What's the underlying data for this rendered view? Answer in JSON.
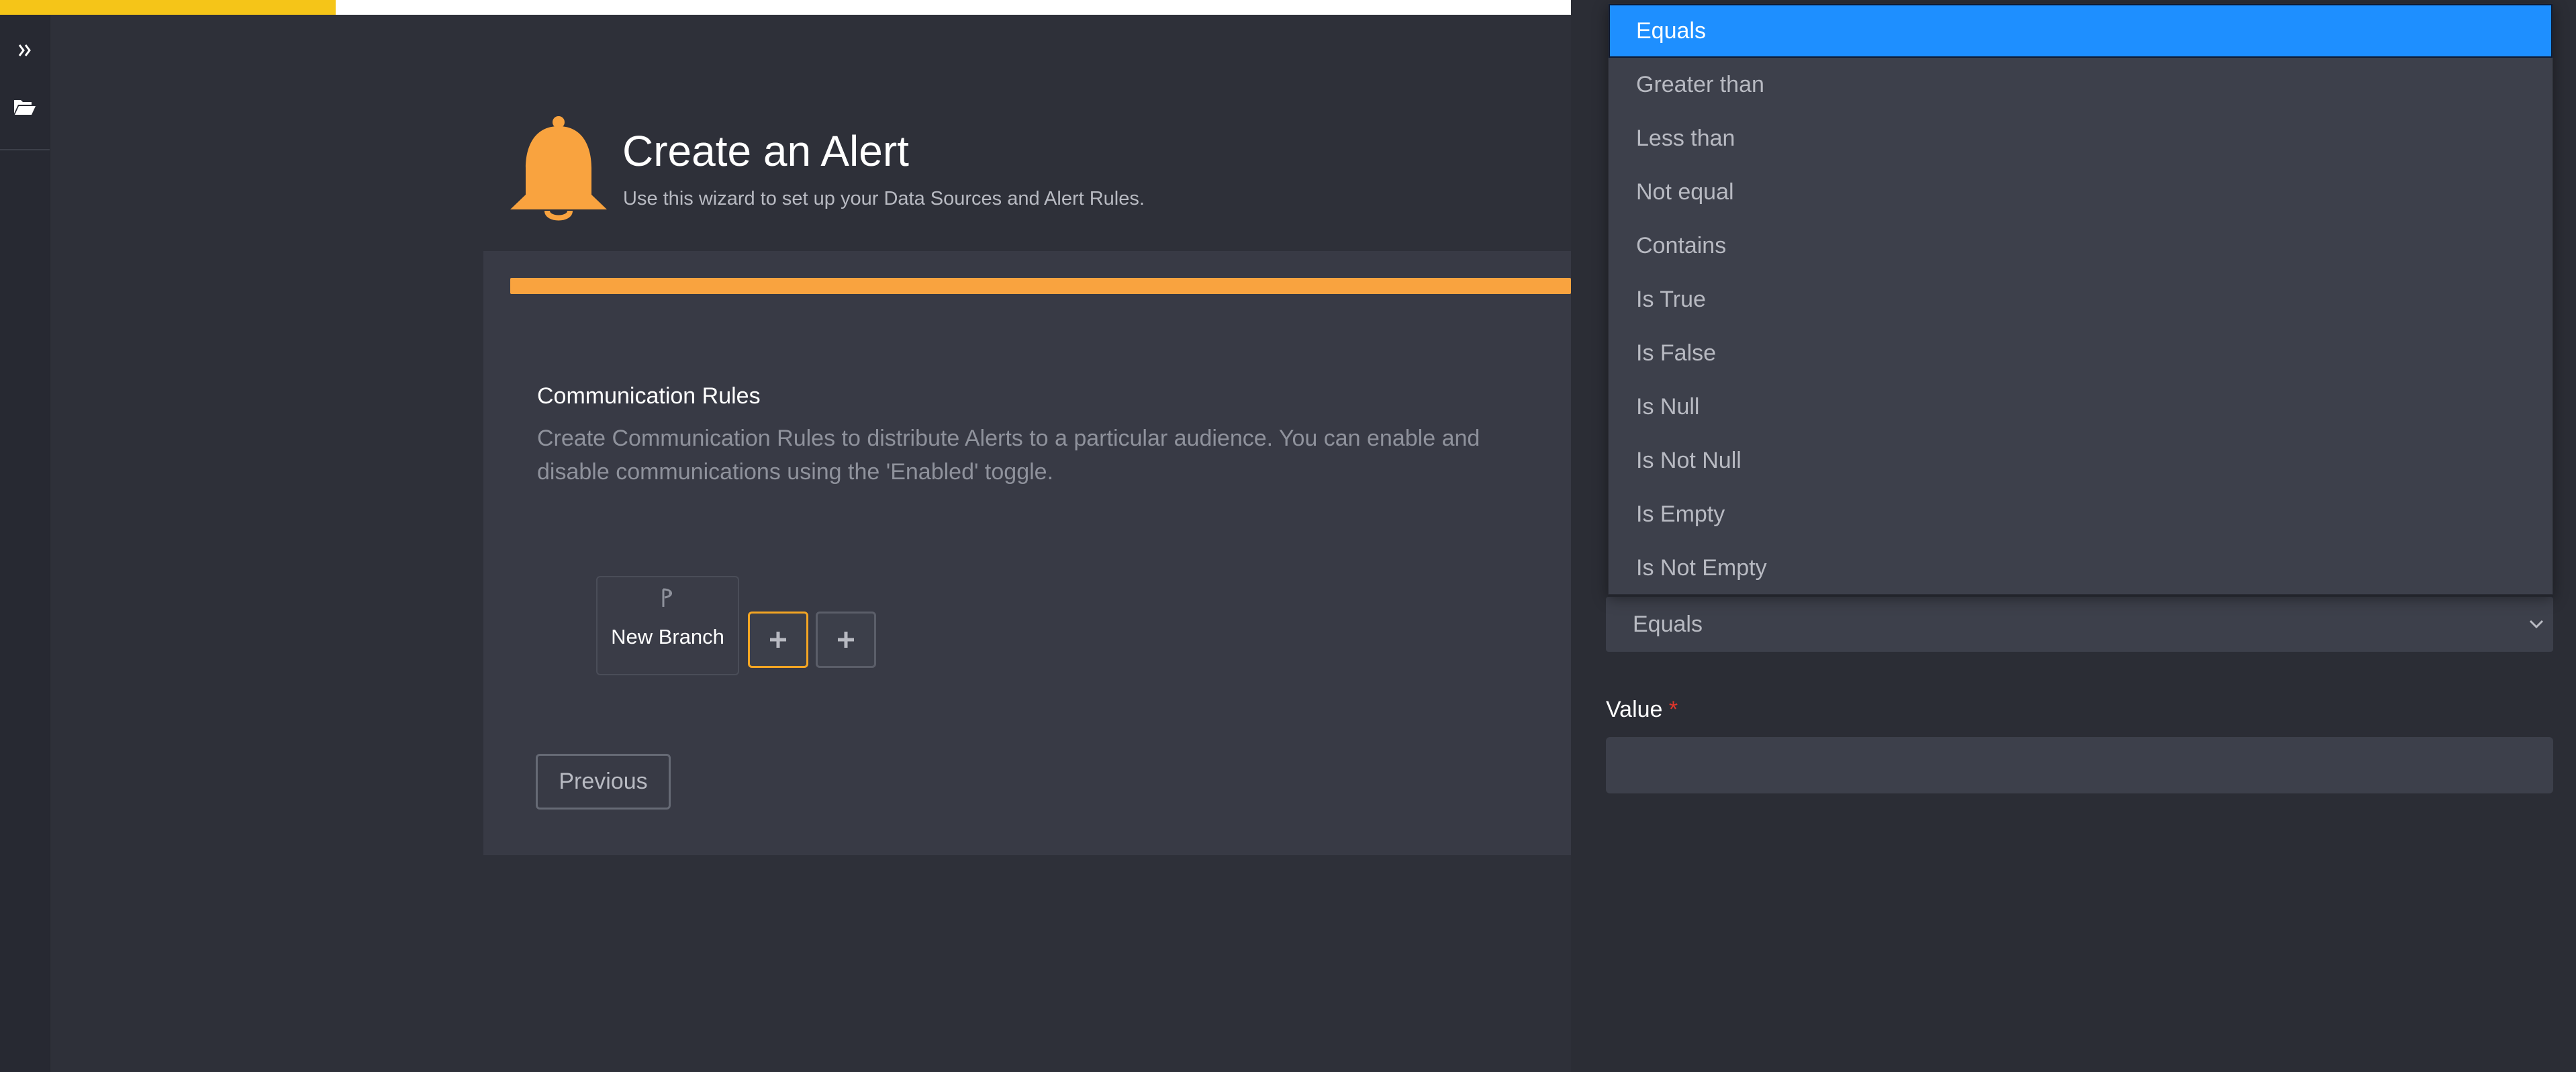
{
  "header": {
    "title": "Create an Alert",
    "subtitle": "Use this wizard to set up your Data Sources and Alert Rules."
  },
  "wizard": {
    "progress_percent": 100,
    "section_title": "Communication Rules",
    "section_description": "Create Communication Rules to distribute Alerts to a particular audience. You can enable and disable communications using the 'Enabled' toggle.",
    "branch_label": "New Branch",
    "add_symbol": "+",
    "previous_label": "Previous"
  },
  "condition": {
    "selected": "Equals",
    "options": [
      "Equals",
      "Greater than",
      "Less than",
      "Not equal",
      "Contains",
      "Is True",
      "Is False",
      "Is Null",
      "Is Not Null",
      "Is Empty",
      "Is Not Empty"
    ]
  },
  "value_field": {
    "label": "Value",
    "required_marker": "*",
    "value": ""
  },
  "colors": {
    "accent": "#f9a33f",
    "highlight": "#1e8fff",
    "background": "#2e3039",
    "card": "#383a45",
    "required": "#e0362c"
  },
  "icons": {
    "rail": [
      "double-chevron-right-icon",
      "folder-open-icon"
    ],
    "header": "bell-icon",
    "branch": "branch-icon",
    "select": "chevron-down-icon"
  }
}
